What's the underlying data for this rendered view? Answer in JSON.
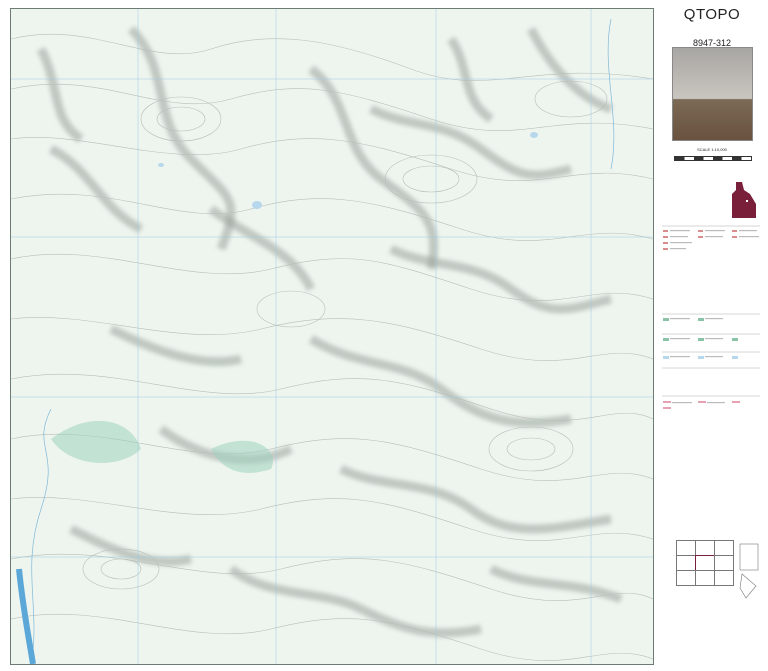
{
  "map": {
    "title": "QTOPO",
    "sheet_number": "8947-312",
    "scale_label": "SCALE 1:10,000",
    "colors": {
      "background": "#eef5ef",
      "contour": "#b9bdb8",
      "hillshade": "#9aa29c",
      "water": "#b7d8ec",
      "creek": "#7fb8d6",
      "river": "#5aa7d8",
      "vegetation": "#9fd1bd",
      "grid": "#9cc9e6",
      "border": "#6c7b73",
      "queensland_highlight": "#7a1f3a"
    },
    "icons": [
      "photo-thumbnail",
      "queensland-locator-icon",
      "orientation-icon"
    ]
  }
}
